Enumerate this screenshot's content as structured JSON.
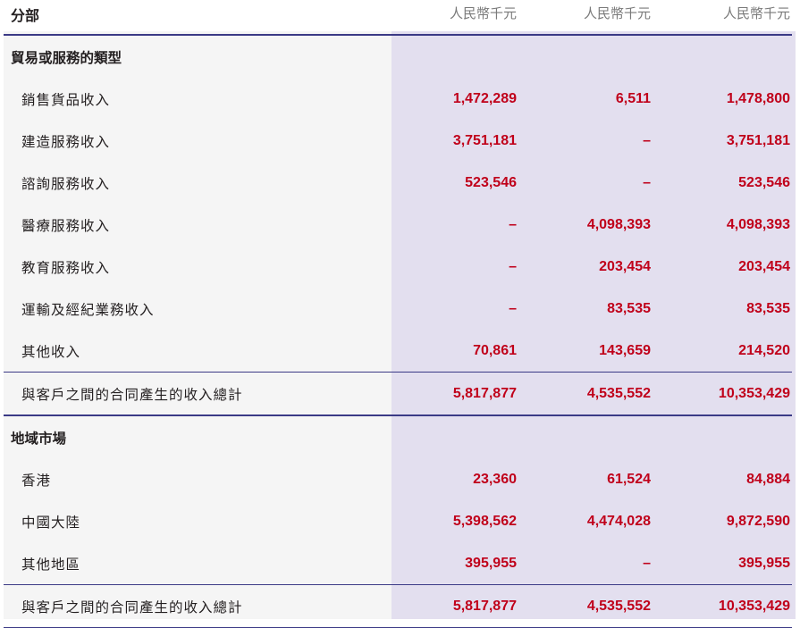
{
  "header": {
    "segment_label": "分部",
    "units": [
      "人民幣千元",
      "人民幣千元",
      "人民幣千元"
    ]
  },
  "sections": [
    {
      "title": "貿易或服務的類型",
      "rows": [
        {
          "label": "銷售貨品收入",
          "values": [
            "1,472,289",
            "6,511",
            "1,478,800"
          ]
        },
        {
          "label": "建造服務收入",
          "values": [
            "3,751,181",
            "–",
            "3,751,181"
          ]
        },
        {
          "label": "諮詢服務收入",
          "values": [
            "523,546",
            "–",
            "523,546"
          ]
        },
        {
          "label": "醫療服務收入",
          "values": [
            "–",
            "4,098,393",
            "4,098,393"
          ]
        },
        {
          "label": "教育服務收入",
          "values": [
            "–",
            "203,454",
            "203,454"
          ]
        },
        {
          "label": "運輸及經紀業務收入",
          "values": [
            "–",
            "83,535",
            "83,535"
          ]
        },
        {
          "label": "其他收入",
          "values": [
            "70,861",
            "143,659",
            "214,520"
          ]
        }
      ],
      "total": {
        "label": "與客戶之間的合同產生的收入總計",
        "values": [
          "5,817,877",
          "4,535,552",
          "10,353,429"
        ]
      }
    },
    {
      "title": "地域市場",
      "rows": [
        {
          "label": "香港",
          "values": [
            "23,360",
            "61,524",
            "84,884"
          ]
        },
        {
          "label": "中國大陸",
          "values": [
            "5,398,562",
            "4,474,028",
            "9,872,590"
          ]
        },
        {
          "label": "其他地區",
          "values": [
            "395,955",
            "–",
            "395,955"
          ]
        }
      ],
      "total": {
        "label": "與客戶之間的合同產生的收入總計",
        "values": [
          "5,817,877",
          "4,535,552",
          "10,353,429"
        ]
      }
    }
  ],
  "colors": {
    "accent_line": "#3b3a86",
    "value_red": "#c0001a",
    "column_shade": "#e3dfef"
  }
}
